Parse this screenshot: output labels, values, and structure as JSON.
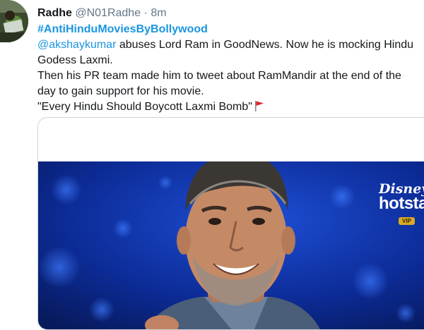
{
  "tweet": {
    "display_name": "Radhe",
    "handle": "@N01Radhe",
    "separator": "·",
    "timestamp": "8m",
    "hashtag": "#AntiHinduMoviesByBollywood",
    "mention": "@akshaykumar",
    "text_1": " abuses Lord Ram in GoodNews. Now he is mocking Hindu",
    "text_2": "Godess Laxmi.",
    "text_3": "Then his PR team made him to tweet about RamMandir at the end of the",
    "text_4": "day to gain support for his movie.",
    "text_5": "\"Every Hindu Should Boycott Laxmi Bomb\"",
    "flag_icon": "red-flag-emoji"
  },
  "media": {
    "brand_line1": "Disney",
    "brand_line2": "hotstar",
    "brand_badge": "VIP"
  },
  "colors": {
    "link": "#1b95e0",
    "text": "#14171a",
    "muted": "#657786",
    "poster_bg": "#0b2a8f"
  }
}
